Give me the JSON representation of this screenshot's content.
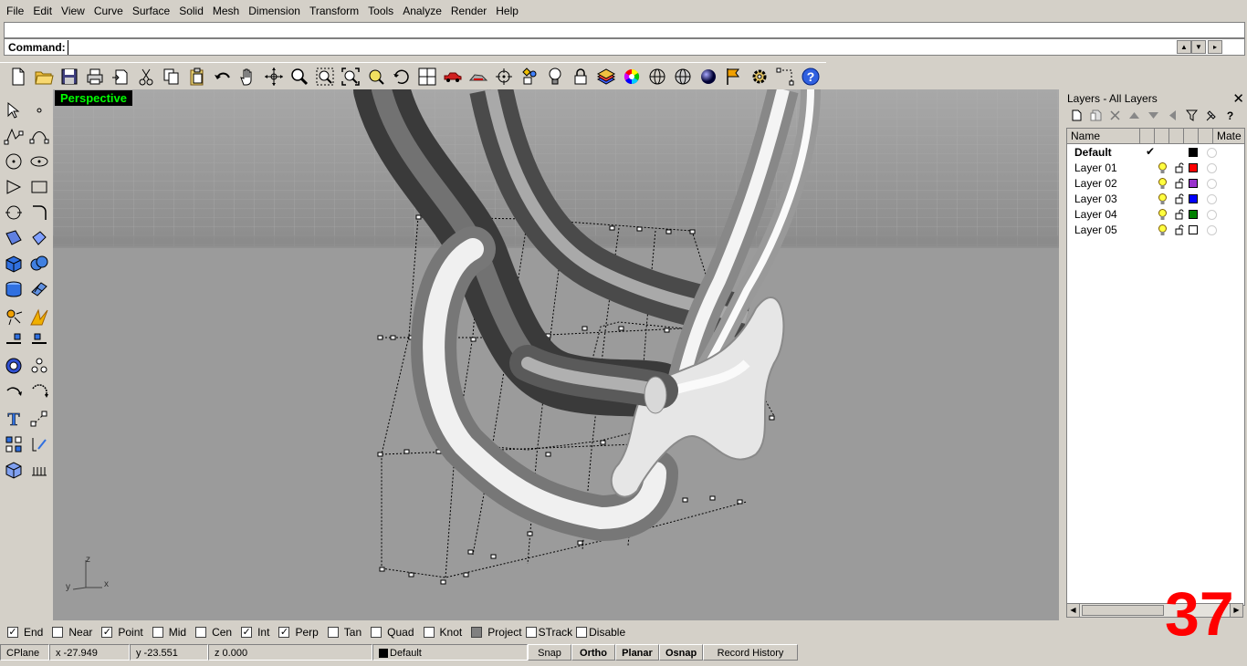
{
  "menu": [
    "File",
    "Edit",
    "View",
    "Curve",
    "Surface",
    "Solid",
    "Mesh",
    "Dimension",
    "Transform",
    "Tools",
    "Analyze",
    "Render",
    "Help"
  ],
  "command": {
    "label": "Command:",
    "value": ""
  },
  "toolbar": {
    "buttons": [
      "new-file-icon",
      "open-folder-icon",
      "save-icon",
      "print-icon",
      "import-icon",
      "cut-icon",
      "copy-icon",
      "paste-icon",
      "undo-icon",
      "pan-hand-icon",
      "rotate-view-icon",
      "zoom-icon",
      "zoom-window-icon",
      "zoom-extents-icon",
      "zoom-selected-icon",
      "rotate-icon",
      "four-viewports-icon",
      "car-icon",
      "render-preview-icon",
      "center-icon",
      "object-properties-icon",
      "light-bulb-icon",
      "lock-icon",
      "layer-icon",
      "color-wheel-icon",
      "wireframe-sphere-icon",
      "shaded-sphere-icon",
      "rendered-sphere-icon",
      "flag-icon",
      "settings-gear-icon",
      "grid-snap-icon",
      "help-icon"
    ]
  },
  "viewport": {
    "name": "Perspective"
  },
  "axes": {
    "z": "z",
    "y": "y",
    "x": "x"
  },
  "layers_panel": {
    "title": "Layers - All Layers",
    "columns": [
      "Name",
      "Mate"
    ],
    "rows": [
      {
        "name": "Default",
        "current": true,
        "color": "#000000"
      },
      {
        "name": "Layer 01",
        "current": false,
        "color": "#ff0000"
      },
      {
        "name": "Layer 02",
        "current": false,
        "color": "#9933cc"
      },
      {
        "name": "Layer 03",
        "current": false,
        "color": "#0000ff"
      },
      {
        "name": "Layer 04",
        "current": false,
        "color": "#008000"
      },
      {
        "name": "Layer 05",
        "current": false,
        "color": "#ffffff"
      }
    ],
    "current_mark": "✔"
  },
  "overlay_number": "37",
  "osnap": [
    {
      "label": "End",
      "checked": true
    },
    {
      "label": "Near",
      "checked": false
    },
    {
      "label": "Point",
      "checked": true
    },
    {
      "label": "Mid",
      "checked": false
    },
    {
      "label": "Cen",
      "checked": false
    },
    {
      "label": "Int",
      "checked": true
    },
    {
      "label": "Perp",
      "checked": true
    },
    {
      "label": "Tan",
      "checked": false
    },
    {
      "label": "Quad",
      "checked": false
    },
    {
      "label": "Knot",
      "checked": false
    },
    {
      "label": "Project",
      "checked": false,
      "disabled": true
    },
    {
      "label": "STrack",
      "checked": false
    },
    {
      "label": "Disable",
      "checked": false
    }
  ],
  "status": {
    "cplane": "CPlane",
    "x": "x -27.949",
    "y": "y -23.551",
    "z": "z 0.000",
    "layer": "Default",
    "snap": "Snap",
    "ortho": "Ortho",
    "planar": "Planar",
    "osnap": "Osnap",
    "record_history": "Record History"
  }
}
